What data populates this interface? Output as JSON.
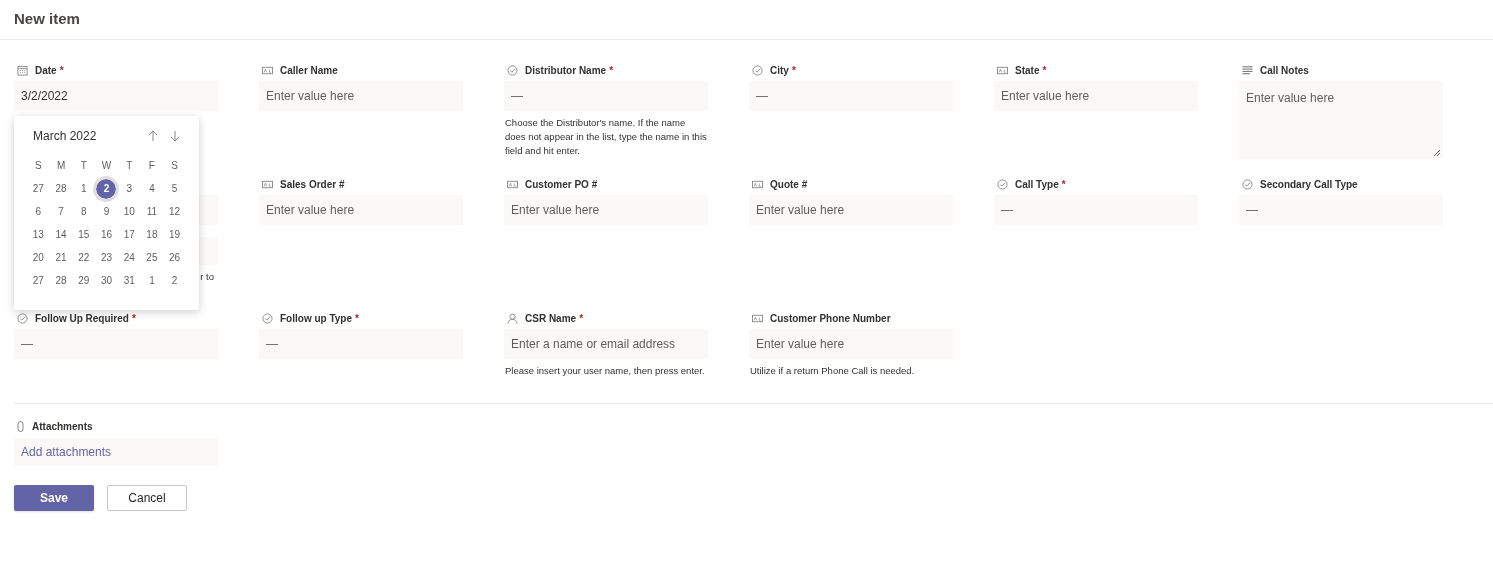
{
  "title": "New item",
  "rows": [
    [
      {
        "kind": "date",
        "label": "Date",
        "required_mark": "*",
        "value": "3/2/2022"
      },
      {
        "kind": "text",
        "label": "Caller Name",
        "placeholder": "Enter value here"
      },
      {
        "kind": "choice",
        "label": "Distributor Name",
        "required_mark": "*",
        "placeholder": "—",
        "helper": "Choose the Distributor's name. If the name does not appear in the list, type the name in this field and hit enter."
      },
      {
        "kind": "choice",
        "label": "City",
        "required_mark": "*",
        "placeholder": "—"
      },
      {
        "kind": "text",
        "label": "State",
        "required_mark": "*",
        "placeholder": "Enter value here"
      },
      {
        "kind": "multiline",
        "label": "Call Notes",
        "placeholder": "Enter value here"
      }
    ],
    [
      {
        "kind": "covered",
        "helper": "r to"
      },
      {
        "kind": "text",
        "label": "Sales Order #",
        "placeholder": "Enter value here"
      },
      {
        "kind": "text",
        "label": "Customer PO #",
        "placeholder": "Enter value here"
      },
      {
        "kind": "text",
        "label": "Quote #",
        "placeholder": "Enter value here"
      },
      {
        "kind": "choice",
        "label": "Call Type",
        "required_mark": "*",
        "placeholder": "—"
      },
      {
        "kind": "choice",
        "label": "Secondary Call Type",
        "placeholder": "—"
      }
    ],
    [
      {
        "kind": "choice",
        "label": "Follow Up Required",
        "required_mark": "*",
        "placeholder": "—"
      },
      {
        "kind": "choice",
        "label": "Follow up Type",
        "required_mark": "*",
        "placeholder": "—"
      },
      {
        "kind": "person",
        "label": "CSR Name",
        "required_mark": "*",
        "placeholder": "Enter a name or email address",
        "helper": "Please insert your user name, then press enter."
      },
      {
        "kind": "text",
        "label": "Customer Phone Number",
        "placeholder": "Enter value here",
        "helper": "Utilize if a return Phone Call is needed."
      }
    ]
  ],
  "calendar": {
    "month": "March 2022",
    "weekdays": [
      "S",
      "M",
      "T",
      "W",
      "T",
      "F",
      "S"
    ],
    "weeks": [
      [
        {
          "day": "27",
          "selected": false
        },
        {
          "day": "28",
          "selected": false
        },
        {
          "day": "1",
          "selected": false
        },
        {
          "day": "2",
          "selected": true
        },
        {
          "day": "3",
          "selected": false
        },
        {
          "day": "4",
          "selected": false
        },
        {
          "day": "5",
          "selected": false
        }
      ],
      [
        {
          "day": "6",
          "selected": false
        },
        {
          "day": "7",
          "selected": false
        },
        {
          "day": "8",
          "selected": false
        },
        {
          "day": "9",
          "selected": false
        },
        {
          "day": "10",
          "selected": false
        },
        {
          "day": "11",
          "selected": false
        },
        {
          "day": "12",
          "selected": false
        }
      ],
      [
        {
          "day": "13",
          "selected": false
        },
        {
          "day": "14",
          "selected": false
        },
        {
          "day": "15",
          "selected": false
        },
        {
          "day": "16",
          "selected": false
        },
        {
          "day": "17",
          "selected": false
        },
        {
          "day": "18",
          "selected": false
        },
        {
          "day": "19",
          "selected": false
        }
      ],
      [
        {
          "day": "20",
          "selected": false
        },
        {
          "day": "21",
          "selected": false
        },
        {
          "day": "22",
          "selected": false
        },
        {
          "day": "23",
          "selected": false
        },
        {
          "day": "24",
          "selected": false
        },
        {
          "day": "25",
          "selected": false
        },
        {
          "day": "26",
          "selected": false
        }
      ],
      [
        {
          "day": "27",
          "selected": false
        },
        {
          "day": "28",
          "selected": false
        },
        {
          "day": "29",
          "selected": false
        },
        {
          "day": "30",
          "selected": false
        },
        {
          "day": "31",
          "selected": false
        },
        {
          "day": "1",
          "selected": false
        },
        {
          "day": "2",
          "selected": false
        }
      ]
    ]
  },
  "attachments": {
    "label": "Attachments",
    "link": "Add attachments"
  },
  "buttons": [
    {
      "label": "Save",
      "kind": "primary"
    },
    {
      "label": "Cancel",
      "kind": "default"
    }
  ]
}
